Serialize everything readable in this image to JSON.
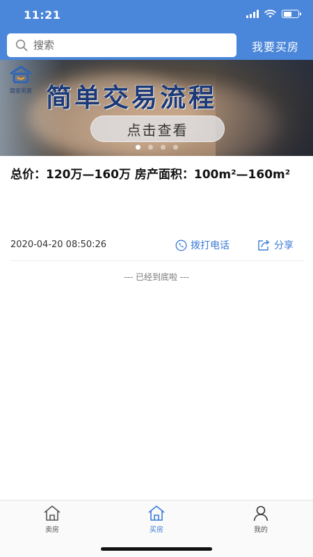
{
  "status_bar": {
    "time": "11:21",
    "battery_level": 0.55
  },
  "search": {
    "placeholder": "搜索",
    "icon": "search-icon"
  },
  "header": {
    "buy_link": "我要买房"
  },
  "banner": {
    "logo_text": "简安买房",
    "title": "简单交易流程",
    "button_label": "点击查看",
    "slide_count": 4,
    "active_slide": 1
  },
  "listing": {
    "title": "总价：120万—160万 房产面积：100m²—160m²",
    "date": "2020-04-20 08:50:26",
    "call_label": "拨打电话",
    "share_label": "分享"
  },
  "list_end_text": "--- 已经到底啦 ---",
  "tabbar": {
    "items": [
      {
        "label": "卖房",
        "icon": "home-icon",
        "active": false
      },
      {
        "label": "买房",
        "icon": "home-icon",
        "active": true
      },
      {
        "label": "我的",
        "icon": "user-icon",
        "active": false
      }
    ]
  },
  "colors": {
    "header": "#4a86d9",
    "accent": "#3a7bd5",
    "banner_title": "#1c3a78"
  }
}
